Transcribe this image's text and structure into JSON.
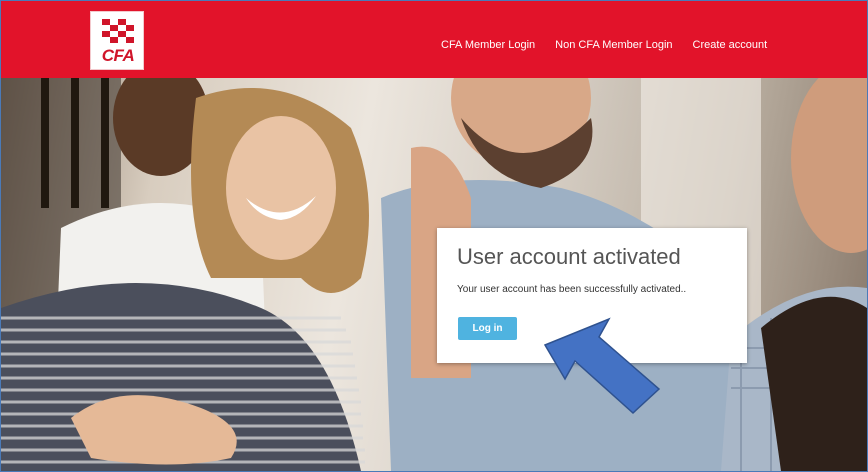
{
  "header": {
    "logo_text": "CFA",
    "nav": [
      {
        "label": "CFA Member Login"
      },
      {
        "label": "Non CFA Member Login"
      },
      {
        "label": "Create account"
      }
    ]
  },
  "card": {
    "title": "User account activated",
    "message": "Your user account has been successfully activated..",
    "button_label": "Log in"
  },
  "colors": {
    "header_red": "#e2132a",
    "button_blue": "#4fb3e0",
    "arrow_blue": "#4472c4"
  }
}
